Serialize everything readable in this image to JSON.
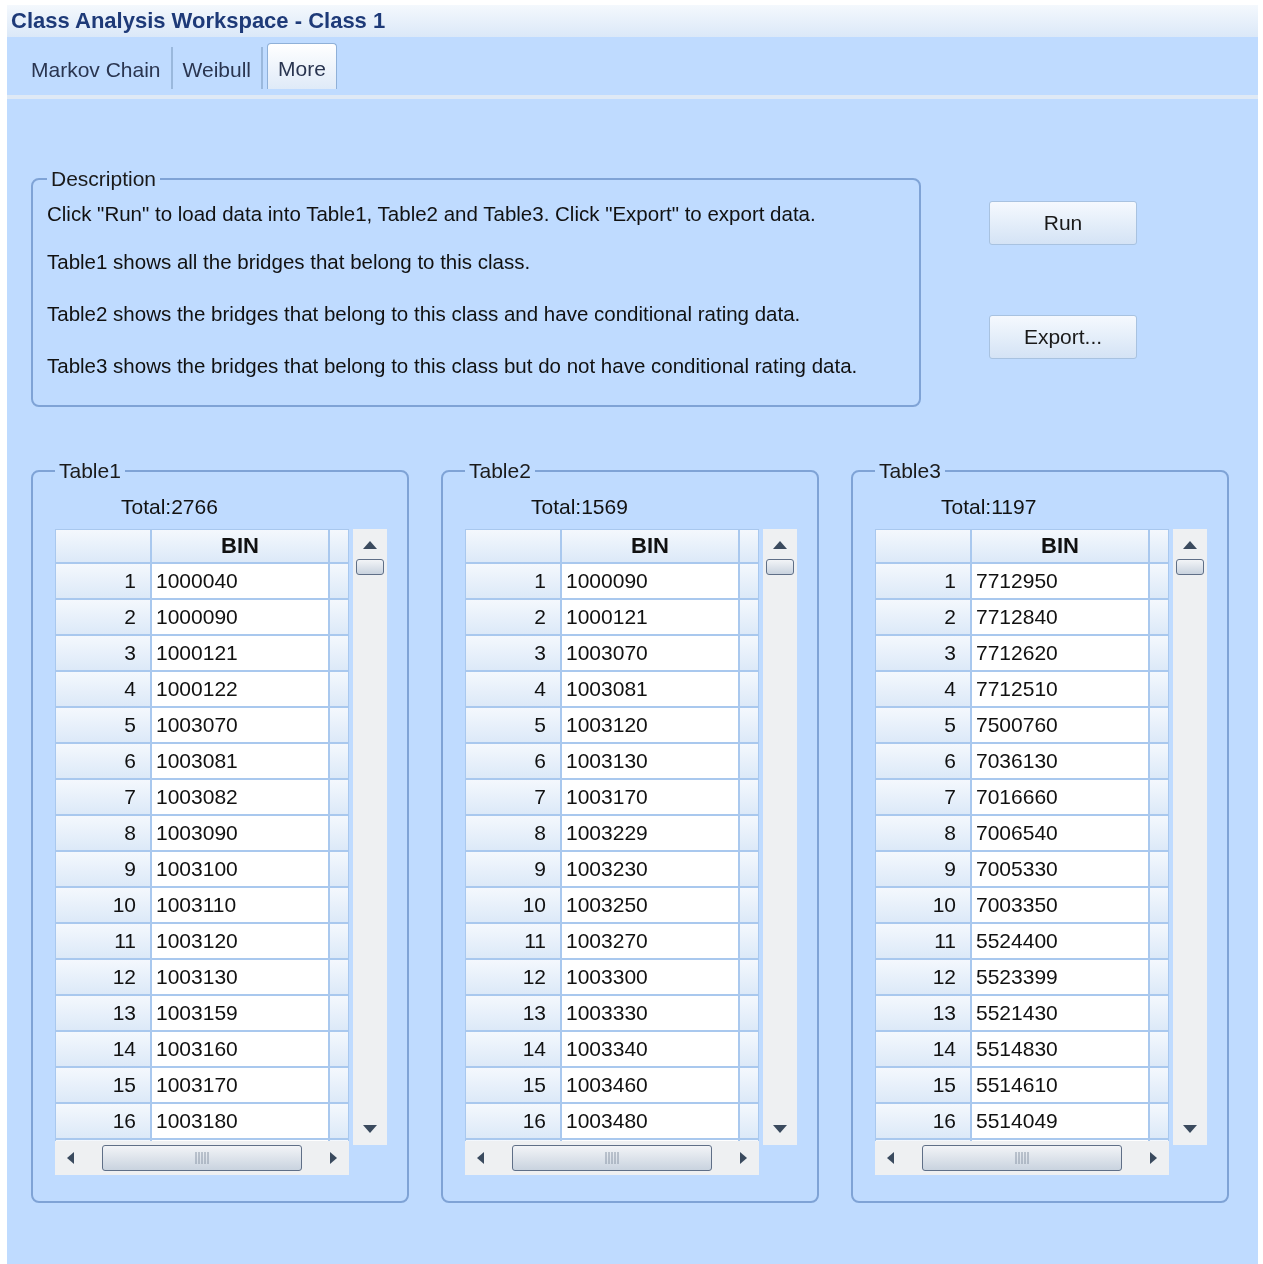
{
  "window": {
    "title": "Class Analysis Workspace - Class 1"
  },
  "tabs": [
    {
      "label": "Markov Chain",
      "selected": false
    },
    {
      "label": "Weibull",
      "selected": false
    },
    {
      "label": "More",
      "selected": true
    }
  ],
  "description": {
    "legend": "Description",
    "lines": [
      "Click \"Run\" to load data into Table1, Table2 and Table3. Click \"Export\" to export data.",
      "Table1 shows all the bridges that belong to this class.",
      "Table2 shows the bridges that belong to this class and have conditional rating data.",
      "Table3 shows the bridges that belong to this class but do not have conditional rating data."
    ]
  },
  "buttons": [
    "Run",
    "Export..."
  ],
  "tables": [
    {
      "legend": "Table1",
      "total": "Total:2766",
      "column": "BIN",
      "rows": [
        [
          "1",
          "1000040"
        ],
        [
          "2",
          "1000090"
        ],
        [
          "3",
          "1000121"
        ],
        [
          "4",
          "1000122"
        ],
        [
          "5",
          "1003070"
        ],
        [
          "6",
          "1003081"
        ],
        [
          "7",
          "1003082"
        ],
        [
          "8",
          "1003090"
        ],
        [
          "9",
          "1003100"
        ],
        [
          "10",
          "1003110"
        ],
        [
          "11",
          "1003120"
        ],
        [
          "12",
          "1003130"
        ],
        [
          "13",
          "1003159"
        ],
        [
          "14",
          "1003160"
        ],
        [
          "15",
          "1003170"
        ],
        [
          "16",
          "1003180"
        ]
      ]
    },
    {
      "legend": "Table2",
      "total": "Total:1569",
      "column": "BIN",
      "rows": [
        [
          "1",
          "1000090"
        ],
        [
          "2",
          "1000121"
        ],
        [
          "3",
          "1003070"
        ],
        [
          "4",
          "1003081"
        ],
        [
          "5",
          "1003120"
        ],
        [
          "6",
          "1003130"
        ],
        [
          "7",
          "1003170"
        ],
        [
          "8",
          "1003229"
        ],
        [
          "9",
          "1003230"
        ],
        [
          "10",
          "1003250"
        ],
        [
          "11",
          "1003270"
        ],
        [
          "12",
          "1003300"
        ],
        [
          "13",
          "1003330"
        ],
        [
          "14",
          "1003340"
        ],
        [
          "15",
          "1003460"
        ],
        [
          "16",
          "1003480"
        ]
      ]
    },
    {
      "legend": "Table3",
      "total": "Total:1197",
      "column": "BIN",
      "rows": [
        [
          "1",
          "7712950"
        ],
        [
          "2",
          "7712840"
        ],
        [
          "3",
          "7712620"
        ],
        [
          "4",
          "7712510"
        ],
        [
          "5",
          "7500760"
        ],
        [
          "6",
          "7036130"
        ],
        [
          "7",
          "7016660"
        ],
        [
          "8",
          "7006540"
        ],
        [
          "9",
          "7005330"
        ],
        [
          "10",
          "7003350"
        ],
        [
          "11",
          "5524400"
        ],
        [
          "12",
          "5523399"
        ],
        [
          "13",
          "5521430"
        ],
        [
          "14",
          "5514830"
        ],
        [
          "15",
          "5514610"
        ],
        [
          "16",
          "5514049"
        ]
      ]
    }
  ]
}
